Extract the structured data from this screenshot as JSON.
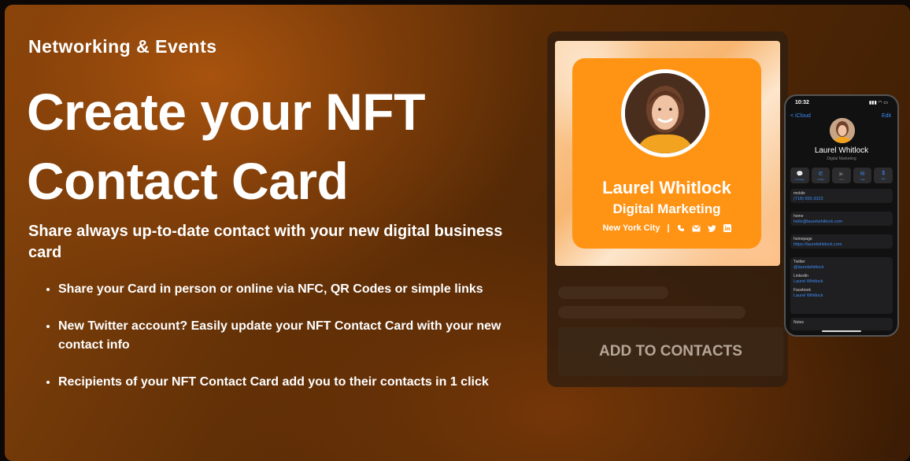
{
  "hero": {
    "eyebrow": "Networking & Events",
    "title_line1": "Create your NFT",
    "title_line2": "Contact Card",
    "subtitle": "Share always up-to-date contact with your new digital business card",
    "bullets": [
      "Share your Card in person or online via NFC, QR Codes or simple links",
      "New Twitter account? Easily update your NFT Contact Card with your new contact info",
      "Recipients of your NFT Contact Card add you to their contacts in 1 click"
    ]
  },
  "card": {
    "name": "Laurel Whitlock",
    "role": "Digital Marketing",
    "location": "New York City",
    "separator": "|",
    "icons": [
      "phone-icon",
      "mail-icon",
      "twitter-icon",
      "linkedin-icon"
    ],
    "add_button": "ADD TO CONTACTS",
    "colors": {
      "card": "#ff9314",
      "accent_bg": "#f7b570"
    }
  },
  "phone": {
    "time": "10:32",
    "status_icons": "▮▮▮ ◠ ▭",
    "back_label": "< iCloud",
    "edit_label": "Edit",
    "name": "Laurel Whitlock",
    "subtitle": "Digital Marketing",
    "actions": [
      {
        "glyph": "💬",
        "label": "message"
      },
      {
        "glyph": "✆",
        "label": "mobile"
      },
      {
        "glyph": "▶",
        "label": "video"
      },
      {
        "glyph": "✉",
        "label": "mail"
      },
      {
        "glyph": "$",
        "label": "pay"
      }
    ],
    "fields": [
      {
        "label": "mobile",
        "value": "(718) 555-3323"
      },
      {
        "label": "home",
        "value": "hello@laurelwhitlock.com"
      },
      {
        "label": "homepage",
        "value": "https://laurelwhitlock.com"
      },
      {
        "label": "Twitter",
        "value": "@laurelwhitlock"
      },
      {
        "label": "LinkedIn",
        "value": "Laurel Whitlock"
      },
      {
        "label": "Facebook",
        "value": "Laurel Whitlock"
      },
      {
        "label": "Notes",
        "value": ""
      }
    ]
  }
}
